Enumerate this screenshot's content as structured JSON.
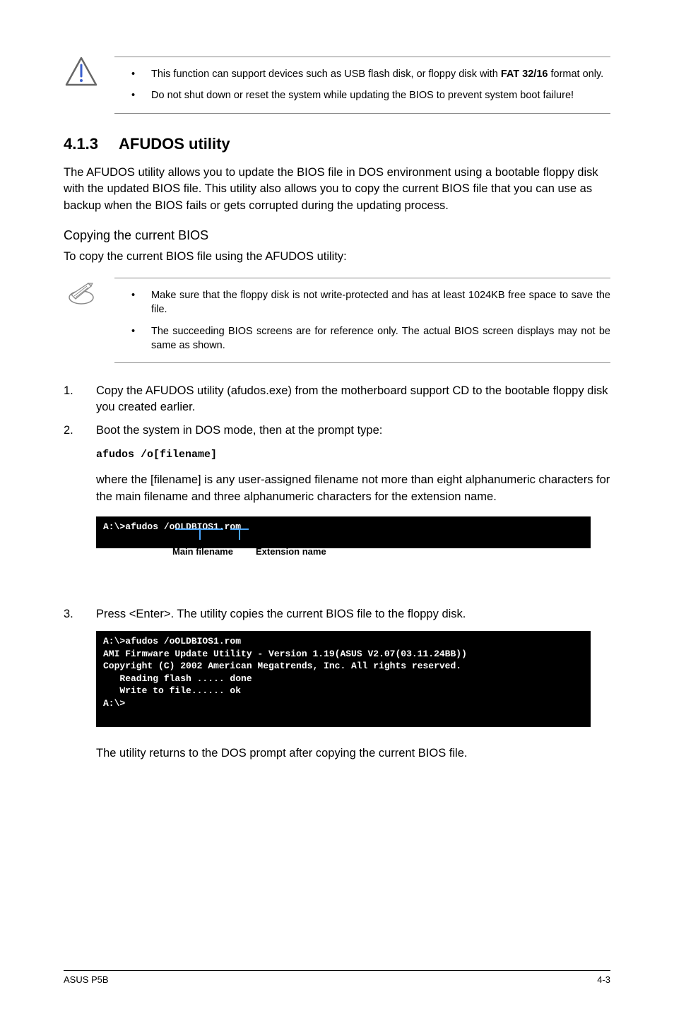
{
  "noticeA": {
    "items": [
      {
        "pre": "This function can support devices such as USB flash disk, or floppy disk with ",
        "bold": "FAT 32/16",
        "post": " format only."
      },
      {
        "pre": "Do not shut down or reset the system while updating the BIOS to prevent system boot failure!",
        "bold": "",
        "post": ""
      }
    ]
  },
  "section": {
    "num": "4.1.3",
    "title": "AFUDOS utility"
  },
  "intro": "The AFUDOS utility allows you to update the BIOS file in DOS environment using a bootable floppy disk with the updated BIOS file. This utility also allows you to copy the current BIOS file that you can use as backup when the BIOS fails or gets corrupted during the updating process.",
  "subheading": "Copying the current BIOS",
  "sublead": "To copy the current BIOS file using the AFUDOS utility:",
  "noticeB": {
    "items": [
      "Make sure that the floppy disk is not write-protected and has at least 1024KB free space to save the file.",
      "The succeeding BIOS screens are for reference only. The actual BIOS screen displays may not be same as shown."
    ]
  },
  "steps": {
    "s1": {
      "n": "1.",
      "t": "Copy the AFUDOS utility (afudos.exe) from the motherboard support CD to the bootable floppy disk you created earlier."
    },
    "s2": {
      "n": "2.",
      "t": "Boot the system in DOS mode, then at the prompt type:"
    },
    "s2cmd": "afudos /o[filename]",
    "s2follow": "where the [filename] is any user-assigned filename not more than eight alphanumeric characters  for the main filename and three alphanumeric characters for the extension name.",
    "s3": {
      "n": "3.",
      "t": "Press <Enter>. The utility copies the current BIOS file to the floppy disk."
    },
    "s3follow": "The utility returns to the DOS prompt after copying the current BIOS file."
  },
  "term1": {
    "line1": "A:\\>afudos /oOLDBIOS1.rom",
    "lblMain": "Main filename",
    "lblExt": "Extension name"
  },
  "term2": {
    "l1": "A:\\>afudos /oOLDBIOS1.rom",
    "l2": "AMI Firmware Update Utility - Version 1.19(ASUS V2.07(03.11.24BB))",
    "l3": "Copyright (C) 2002 American Megatrends, Inc. All rights reserved.",
    "l4": "   Reading flash ..... done",
    "l5": "   Write to file...... ok",
    "l6": "A:\\>"
  },
  "footer": {
    "left": "ASUS P5B",
    "right": "4-3"
  }
}
